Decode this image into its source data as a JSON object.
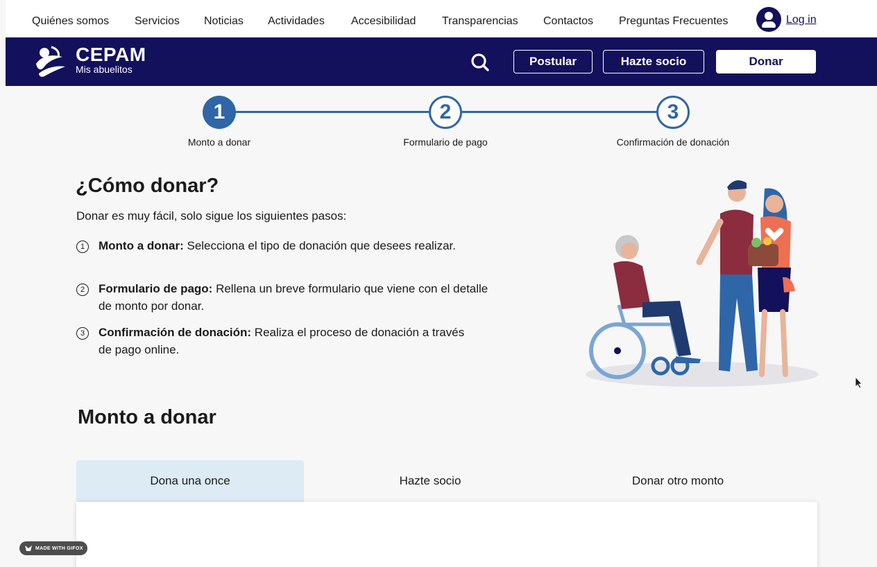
{
  "topnav": {
    "links": [
      "Quiénes somos",
      "Servicios",
      "Noticias",
      "Actividades",
      "Accesibilidad",
      "Transparencias",
      "Contactos",
      "Preguntas Frecuentes"
    ],
    "login_label": "Log in",
    "user_icon": "user-circle-icon"
  },
  "brand": {
    "name": "CEPAM",
    "tagline": "Mis abuelitos",
    "logo_icon": "cepam-logo",
    "search_icon": "search-icon",
    "postular_label": "Postular",
    "socio_label": "Hazte socio",
    "donar_label": "Donar",
    "bar_color": "#13105c"
  },
  "stepper": {
    "accent": "#2f66a8",
    "steps": [
      {
        "number": "1",
        "label": "Monto a donar",
        "active": true
      },
      {
        "number": "2",
        "label": "Formulario de pago",
        "active": false
      },
      {
        "number": "3",
        "label": "Confirmación de donación",
        "active": false
      }
    ]
  },
  "howto": {
    "title": "¿Cómo donar?",
    "intro": "Donar es muy fácil, solo sigue los siguientes pasos:",
    "items": [
      {
        "num": "1",
        "bold": "Monto a donar:",
        "text": " Selecciona el tipo de donación que desees realizar."
      },
      {
        "num": "2",
        "bold": "Formulario de pago:",
        "text": " Rellena un breve formulario que viene con el detalle de monto por donar."
      },
      {
        "num": "3",
        "bold": "Confirmación de donación:",
        "text": " Realiza el proceso de donación a través de pago online."
      }
    ]
  },
  "donation": {
    "title": "Monto a donar",
    "tabs": [
      "Dona una once",
      "Hazte socio",
      "Donar otro monto"
    ],
    "active_tab": 0,
    "active_tab_color": "#dcebf4"
  },
  "watermark": "MADE WITH GIFOX"
}
